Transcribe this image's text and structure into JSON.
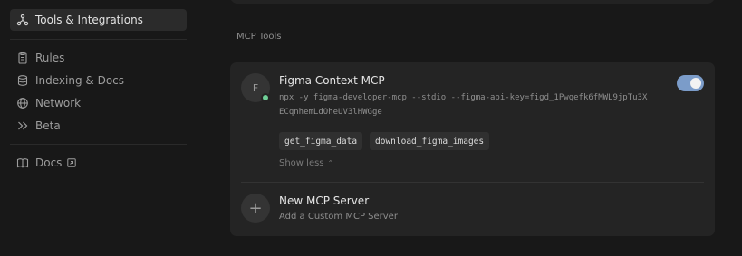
{
  "sidebar": {
    "items": [
      {
        "label": "Tools & Integrations",
        "icon": "integrations-icon",
        "active": true
      },
      {
        "label": "Rules",
        "icon": "clipboard-icon"
      },
      {
        "label": "Indexing & Docs",
        "icon": "database-icon"
      },
      {
        "label": "Network",
        "icon": "globe-icon"
      },
      {
        "label": "Beta",
        "icon": "chevrons-right-icon"
      },
      {
        "label": "Docs",
        "icon": "book-icon"
      }
    ]
  },
  "main": {
    "section_title": "MCP Tools",
    "server": {
      "avatar_letter": "F",
      "name": "Figma Context MCP",
      "command": "npx -y figma-developer-mcp --stdio --figma-api-key=figd_1Pwqefk6fMWL9jpTu3XECqnhemLdOheUV3lHWGge",
      "enabled": true,
      "tools": [
        "get_figma_data",
        "download_figma_images"
      ],
      "show_less_label": "Show less"
    },
    "new_server": {
      "title": "New MCP Server",
      "subtitle": "Add a Custom MCP Server"
    }
  },
  "colors": {
    "background": "#181818",
    "card": "#242424",
    "toggle_on": "#7b9cc9",
    "status_ok": "#6fcf97"
  }
}
